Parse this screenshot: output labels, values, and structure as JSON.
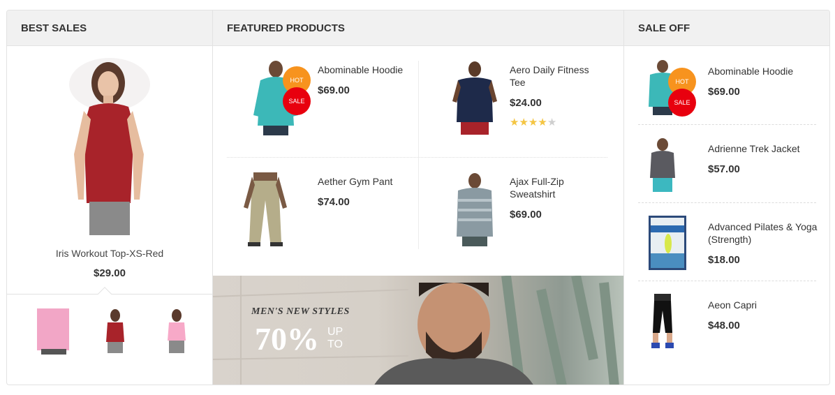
{
  "best_sales": {
    "header": "BEST SALES",
    "product": {
      "name": "Iris Workout Top-XS-Red",
      "price": "$29.00"
    },
    "thumbnails": [
      "pink-top-thumbnail",
      "red-top-thumbnail",
      "pink-back-thumbnail"
    ]
  },
  "featured": {
    "header": "FEATURED PRODUCTS",
    "products": [
      {
        "name": "Abominable Hoodie",
        "price": "$69.00",
        "badges": [
          "HOT",
          "SALE"
        ]
      },
      {
        "name": "Aero Daily Fitness Tee",
        "price": "$24.00",
        "rating": 4,
        "rating_max": 5
      },
      {
        "name": "Aether Gym Pant",
        "price": "$74.00"
      },
      {
        "name": "Ajax Full-Zip Sweatshirt",
        "price": "$69.00"
      }
    ],
    "banner": {
      "title": "MEN'S NEW STYLES",
      "percent": "70%",
      "up": "UP",
      "to": "TO"
    }
  },
  "sale_off": {
    "header": "SALE OFF",
    "products": [
      {
        "name": "Abominable Hoodie",
        "price": "$69.00",
        "badges": [
          "HOT",
          "SALE"
        ]
      },
      {
        "name": "Adrienne Trek Jacket",
        "price": "$57.00"
      },
      {
        "name": "Advanced Pilates & Yoga (Strength)",
        "price": "$18.00"
      },
      {
        "name": "Aeon Capri",
        "price": "$48.00"
      }
    ]
  },
  "colors": {
    "hot_badge": "#f7931e",
    "sale_badge": "#e8000e",
    "star": "#f4c543",
    "header_bg": "#f1f1f1"
  }
}
